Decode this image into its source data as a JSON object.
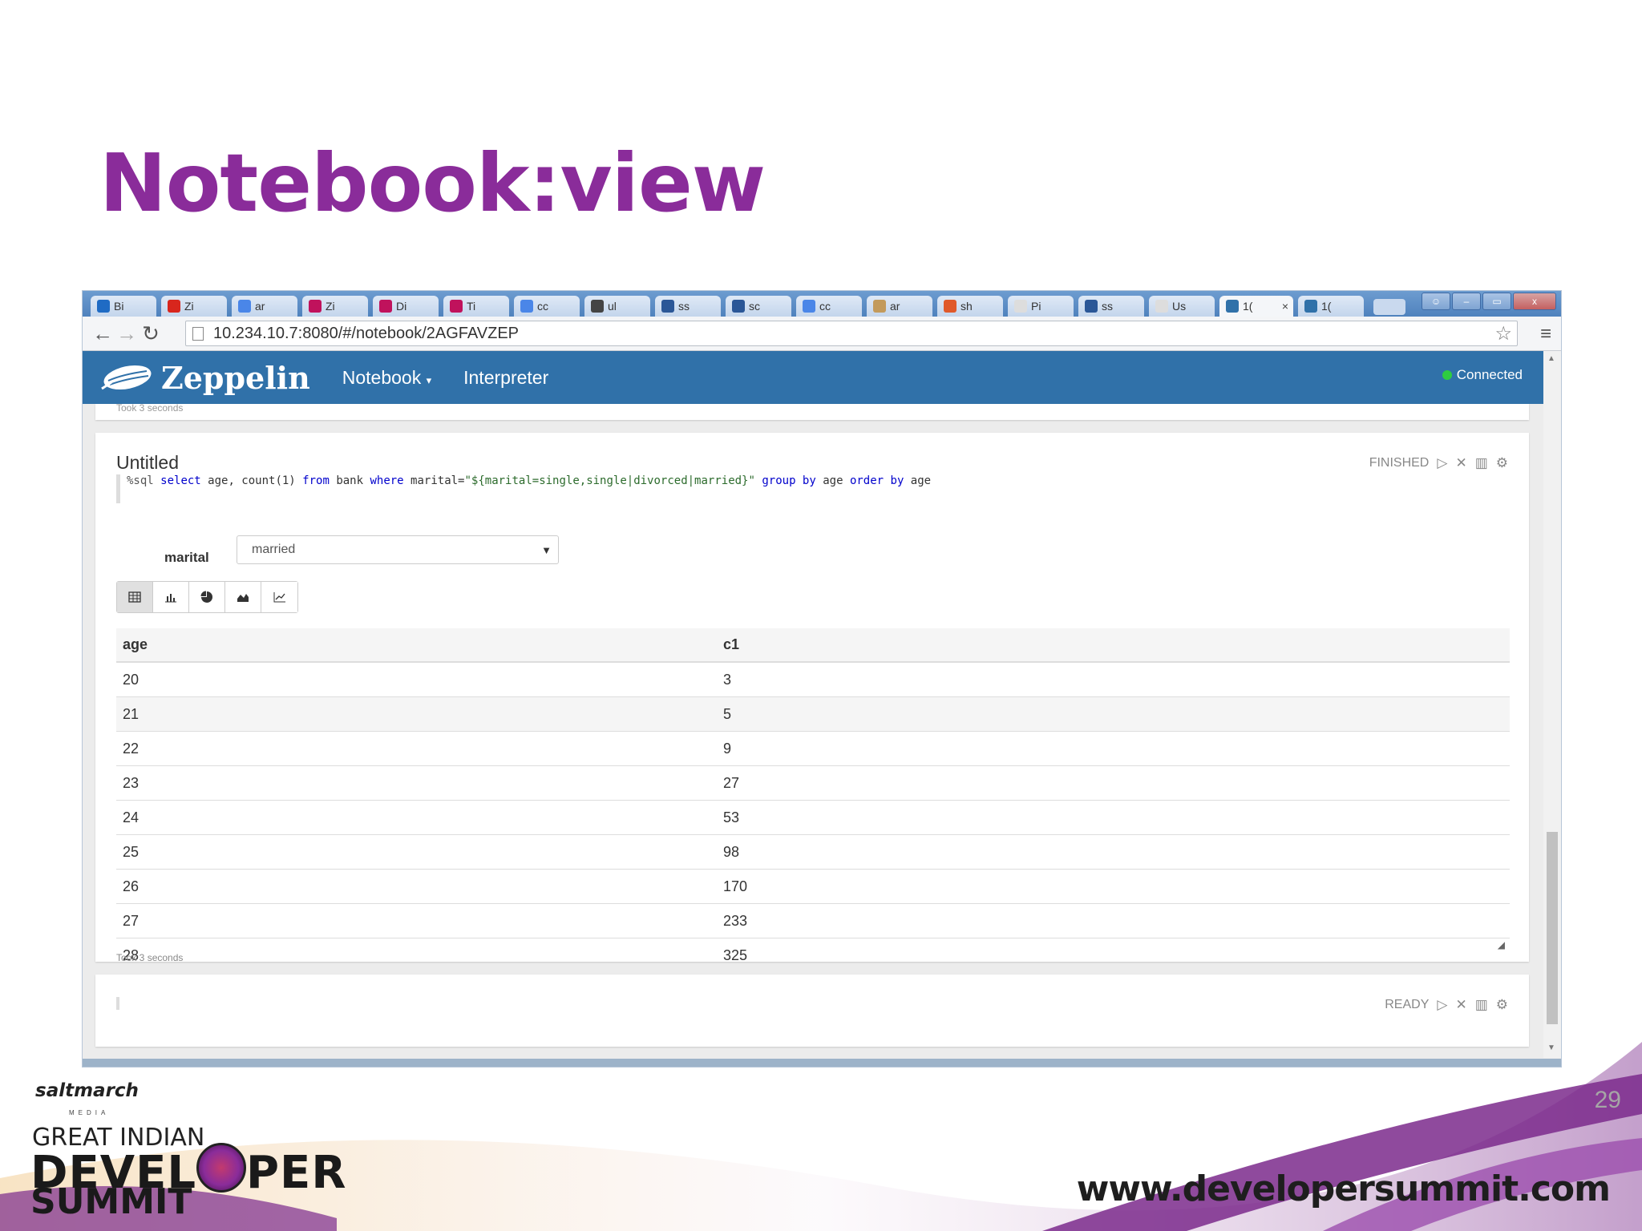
{
  "slide": {
    "title": "Notebook:view",
    "page_number": "29",
    "footer_url": "www.developersummit.com",
    "logo_brand": "saltmarch",
    "logo_media": "MEDIA",
    "event_line1": "GREAT INDIAN",
    "event_line2a": "DEVEL",
    "event_line2b": "PER",
    "event_line3": "SUMMIT"
  },
  "browser": {
    "tabs": [
      {
        "label": "Bi",
        "icon": "outlook-icon",
        "color": "#1f6bc4"
      },
      {
        "label": "Zi",
        "icon": "youtube-icon",
        "color": "#d8261d"
      },
      {
        "label": "ar",
        "icon": "google-icon",
        "color": "#4a86e8"
      },
      {
        "label": "Zi",
        "icon": "pen-icon",
        "color": "#c0125c"
      },
      {
        "label": "Di",
        "icon": "pen-icon",
        "color": "#c0125c"
      },
      {
        "label": "Ti",
        "icon": "pen-icon",
        "color": "#c0125c"
      },
      {
        "label": "cc",
        "icon": "google-icon",
        "color": "#4a86e8"
      },
      {
        "label": "ul",
        "icon": "bars-icon",
        "color": "#444444"
      },
      {
        "label": "ss",
        "icon": "bracket-icon",
        "color": "#2b5797"
      },
      {
        "label": "sc",
        "icon": "paren-icon",
        "color": "#2b5797"
      },
      {
        "label": "cc",
        "icon": "google-icon",
        "color": "#4a86e8"
      },
      {
        "label": "ar",
        "icon": "ant-icon",
        "color": "#c39a5b"
      },
      {
        "label": "sh",
        "icon": "ask-icon",
        "color": "#e0592a"
      },
      {
        "label": "Pi",
        "icon": "page-icon",
        "color": "#dddddd"
      },
      {
        "label": "ss",
        "icon": "bracket-icon",
        "color": "#2b5797"
      },
      {
        "label": "Us",
        "icon": "page-icon",
        "color": "#dddddd"
      },
      {
        "label": "1(",
        "icon": "zeppelin-icon",
        "color": "#3071a9",
        "active": true
      },
      {
        "label": "1(",
        "icon": "zeppelin-icon",
        "color": "#3071a9"
      }
    ],
    "address": "10.234.10.7:8080/#/notebook/2AGFAVZEP",
    "window_controls": {
      "min": "–",
      "restore": "▭",
      "close": "x"
    }
  },
  "zeppelin": {
    "brand": "Zeppelin",
    "nav": {
      "notebook": "Notebook",
      "interpreter": "Interpreter"
    },
    "status": "Connected",
    "status_color": "#2ecc40",
    "header_color": "#3071a9",
    "prev_paragraph_took": "Took 3 seconds",
    "paragraph": {
      "title": "Untitled",
      "state": "FINISHED",
      "code": {
        "prefix": "%sql ",
        "kw_select": "select",
        "cols": " age, count(1) ",
        "kw_from": "from",
        "table": " bank ",
        "kw_where": "where",
        "cond": " marital=",
        "literal": "\"${marital=single,single|divorced|married}\"",
        "kw_group": " group by",
        "group_col": " age ",
        "kw_order": "order by",
        "order_col": " age"
      },
      "form_label": "marital",
      "form_value": "married",
      "viz_buttons": [
        "table-icon",
        "bar-chart-icon",
        "pie-chart-icon",
        "area-chart-icon",
        "line-chart-icon"
      ],
      "table": {
        "headers": [
          "age",
          "c1"
        ],
        "rows": [
          [
            "20",
            "3"
          ],
          [
            "21",
            "5"
          ],
          [
            "22",
            "9"
          ],
          [
            "23",
            "27"
          ],
          [
            "24",
            "53"
          ],
          [
            "25",
            "98"
          ],
          [
            "26",
            "170"
          ],
          [
            "27",
            "233"
          ],
          [
            "28",
            "325"
          ]
        ]
      },
      "took": "Took 3 seconds"
    },
    "next_paragraph_state": "READY"
  },
  "colors": {
    "title_purple": "#8a2c9a",
    "swoosh_purple": "#7b2a8c",
    "swoosh_orange": "#e8a33a"
  }
}
